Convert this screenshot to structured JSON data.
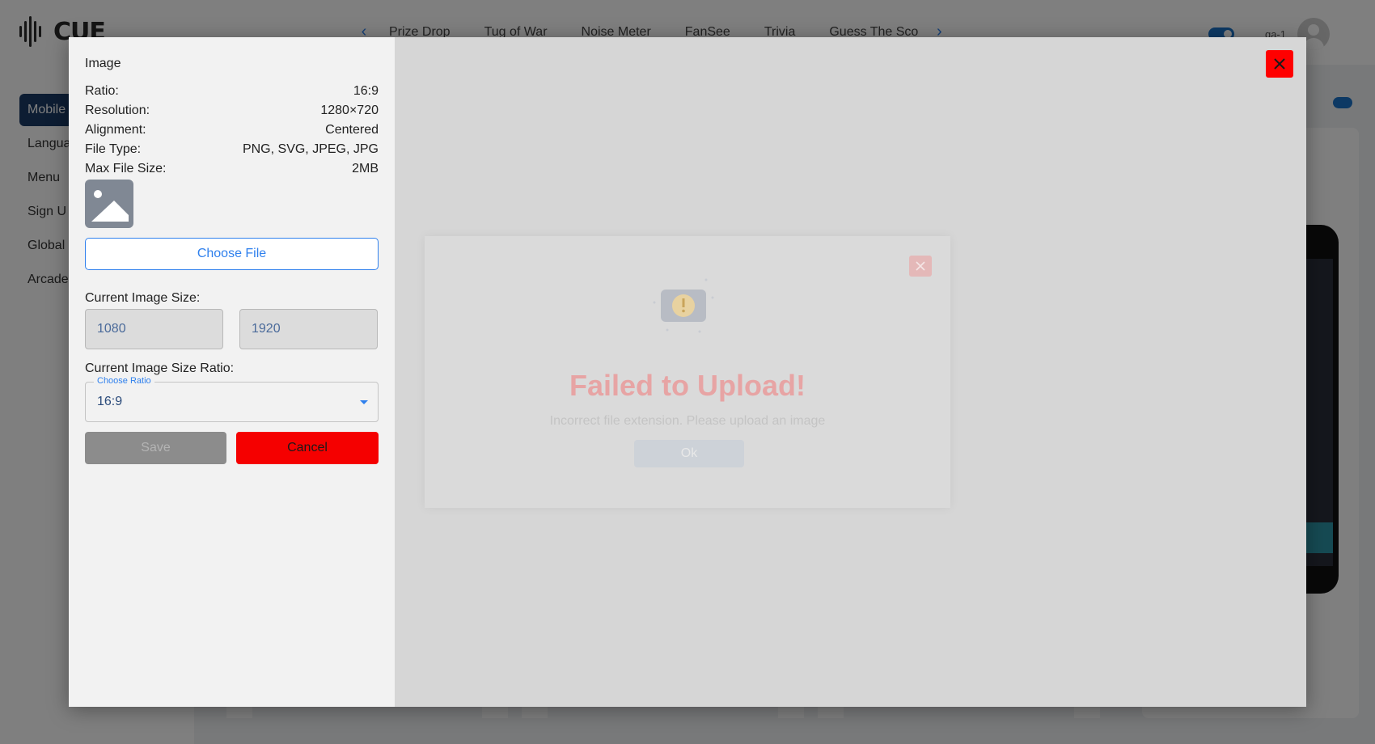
{
  "app": {
    "logo_text": "CUE",
    "user_name": "qa-1"
  },
  "nav_tabs": [
    "Prize Drop",
    "Tug of War",
    "Noise Meter",
    "FanSee",
    "Trivia",
    "Guess The Sco"
  ],
  "sidebar": {
    "items": [
      "Mobile",
      "Langua",
      "Menu",
      "Sign U",
      "Global",
      "Arcade"
    ]
  },
  "image_modal": {
    "title": "Image",
    "specs": [
      {
        "label": "Ratio:",
        "value": "16:9"
      },
      {
        "label": "Resolution:",
        "value": "1280×720"
      },
      {
        "label": "Alignment:",
        "value": "Centered"
      },
      {
        "label": "File Type:",
        "value": "PNG, SVG, JPEG, JPG"
      },
      {
        "label": "Max File Size:",
        "value": "2MB"
      }
    ],
    "choose_file_label": "Choose File",
    "current_size_label": "Current Image Size:",
    "width_value": "1080",
    "height_value": "1920",
    "ratio_label": "Current Image Size Ratio:",
    "ratio_select": {
      "legend": "Choose Ratio",
      "value": "16:9"
    },
    "save_label": "Save",
    "cancel_label": "Cancel"
  },
  "error_dialog": {
    "title": "Failed to Upload!",
    "message": "Incorrect file extension. Please upload an image",
    "ok_label": "Ok"
  },
  "colors": {
    "accent": "#2f80ed",
    "danger": "#f50000",
    "sidebar_active": "#1b3a66",
    "error_title": "#e7a4a4"
  }
}
